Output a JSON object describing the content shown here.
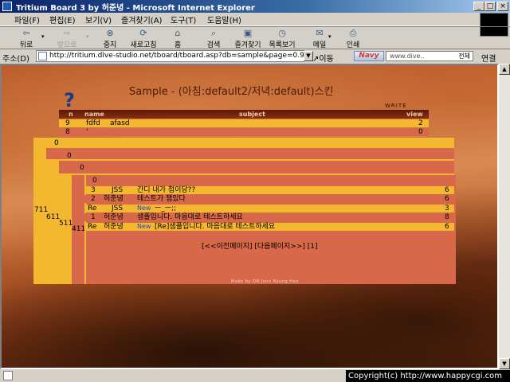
{
  "window": {
    "title": "Tritium Board 3 by 허준녕 - Microsoft Internet Explorer",
    "controls": [
      "_",
      "□",
      "×"
    ]
  },
  "menu": [
    "파일(F)",
    "편집(E)",
    "보기(V)",
    "즐겨찾기(A)",
    "도구(T)",
    "도움말(H)"
  ],
  "toolbar": {
    "back": "뒤로",
    "forward": "앞으로",
    "stop": "중지",
    "refresh": "새로고침",
    "home": "홈",
    "search": "검색",
    "favorites": "즐겨찾기",
    "history": "목록보기",
    "mail": "메일",
    "print": "인쇄"
  },
  "address": {
    "label": "주소(D)",
    "url": "http://tritium.dive-studio.net/tboard/tboard.asp?db=sample&page=0.9",
    "go": "이동",
    "navy_logo": "Navy",
    "search_text": "www.dive..",
    "search_scope": "전체",
    "links": "연결"
  },
  "board": {
    "title": "Sample - (아침:default2/저녁:default)스킨",
    "qmark": "?",
    "write": "WRITE",
    "headers": {
      "n": "n",
      "name": "name",
      "subject": "subject",
      "view": "view"
    },
    "top_rows": [
      {
        "n": "9",
        "name": "fdfd",
        "subject": "afasd",
        "view": "2"
      },
      {
        "n": "8",
        "name": "'",
        "subject": "",
        "view": "0"
      }
    ],
    "nest_zeros": [
      "0",
      "0",
      "0",
      "0"
    ],
    "side_numbers": [
      "711",
      "611",
      "511",
      "411"
    ],
    "posts": [
      {
        "n": "3",
        "name": "JSS",
        "subject": "간디 내가 첨이당??",
        "view": "6",
        "new": false
      },
      {
        "n": "2",
        "name": "허준녕",
        "subject": "테스트가 잼있다",
        "view": "6",
        "new": false
      },
      {
        "n": "Re",
        "name": "JSS",
        "subject": "ㅡ_ㅡ;;",
        "view": "3",
        "new": true
      },
      {
        "n": "1",
        "name": "허준녕",
        "subject": "샘플입니다. 마음대로 테스트하세요",
        "view": "8",
        "new": false
      },
      {
        "n": "Re",
        "name": "허준녕",
        "subject": "[Re]샘플입니다. 마음대로 테스트하세요",
        "view": "6",
        "new": true
      }
    ],
    "new_mark": "New",
    "pager": "[<<이전페이지] [다음페이지>>]  [1]",
    "madeby": "Made by DN Joon Nyung Heo"
  },
  "status": {
    "copyright": "Copyright(c) http://www.happycgi.com"
  },
  "colors": {
    "title_bar": "#0a246a",
    "frame_yellow": "#f4b830",
    "frame_red": "#d8684a",
    "header_dark": "#5a1a08"
  }
}
